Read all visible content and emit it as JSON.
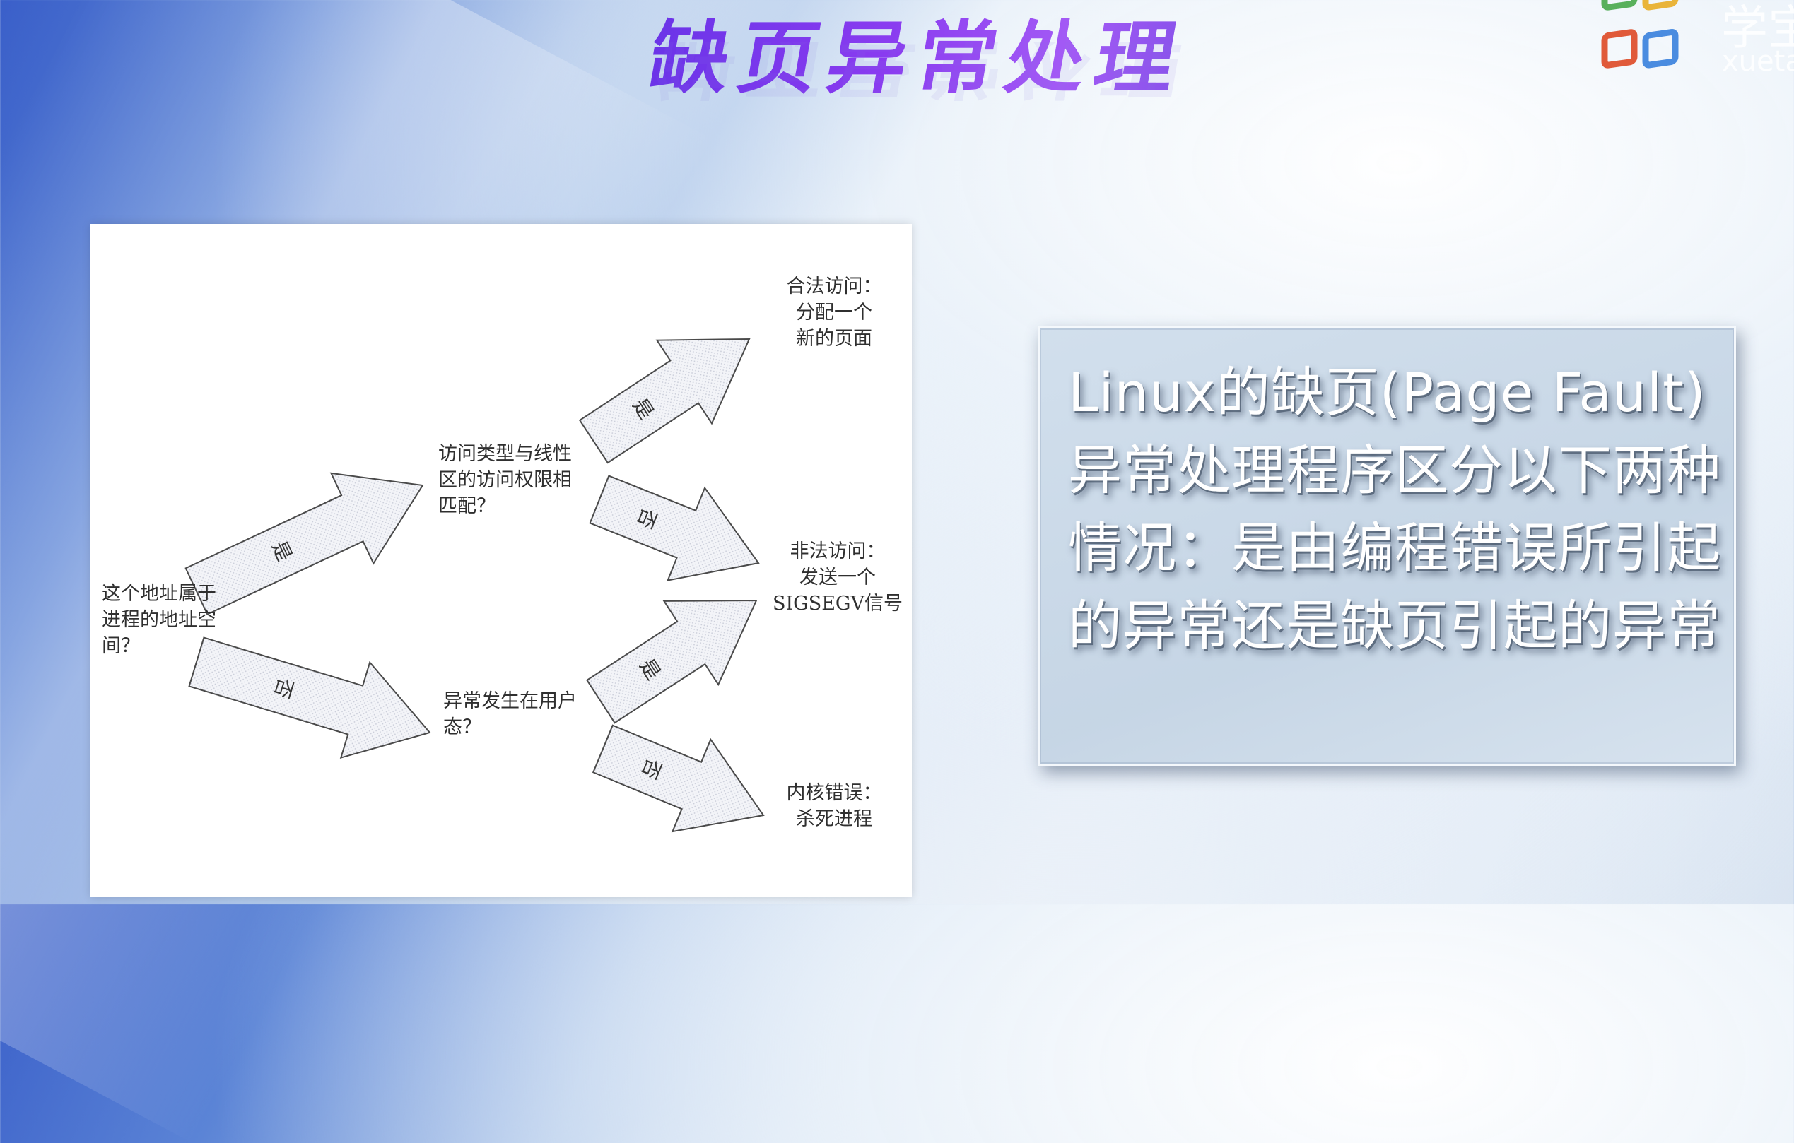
{
  "slide": {
    "title": "缺页异常处理",
    "logo_text": "学宝",
    "logo_subtext": "xuetang",
    "colors": {
      "title_gradient_start": "#6b34e8",
      "title_gradient_end": "#a35af5",
      "textbox_bg": "#c8d8e8",
      "text_white": "#ffffff"
    }
  },
  "diagram": {
    "nodes": {
      "question_address_space": "这个地址属于\n进程的地址空\n间？",
      "question_access_match": "访问类型与线性\n区的访问权限相\n匹配？",
      "question_user_mode": "异常发生在用户\n态？",
      "result_legal": "合法访问：\n分配一个\n新的页面",
      "result_illegal": "非法访问：\n发送一个\nSIGSEGV信号",
      "result_kernel": "内核错误：\n杀死进程"
    },
    "arrow_labels": {
      "yes": "是",
      "no": "否"
    },
    "arrow_icon": "fat-arrow-icon"
  },
  "textbox": {
    "text": "Linux的缺页(Page Fault)异常处理程序区分以下两种情况：是由编程错误所引起的异常还是缺页引起的异常"
  }
}
